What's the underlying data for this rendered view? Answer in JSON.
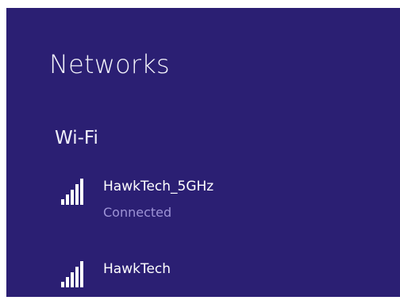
{
  "panel": {
    "title": "Networks",
    "background": "#2b1f73"
  },
  "wifi": {
    "section_label": "Wi-Fi",
    "networks": [
      {
        "name": "HawkTech_5GHz",
        "status": "Connected",
        "signal_icon": "wifi-signal-icon",
        "signal_bars": 5
      },
      {
        "name": "HawkTech",
        "status": "",
        "signal_icon": "wifi-signal-icon",
        "signal_bars": 5
      }
    ]
  },
  "colors": {
    "text": "#ffffff",
    "status_text": "#9d93d6"
  }
}
